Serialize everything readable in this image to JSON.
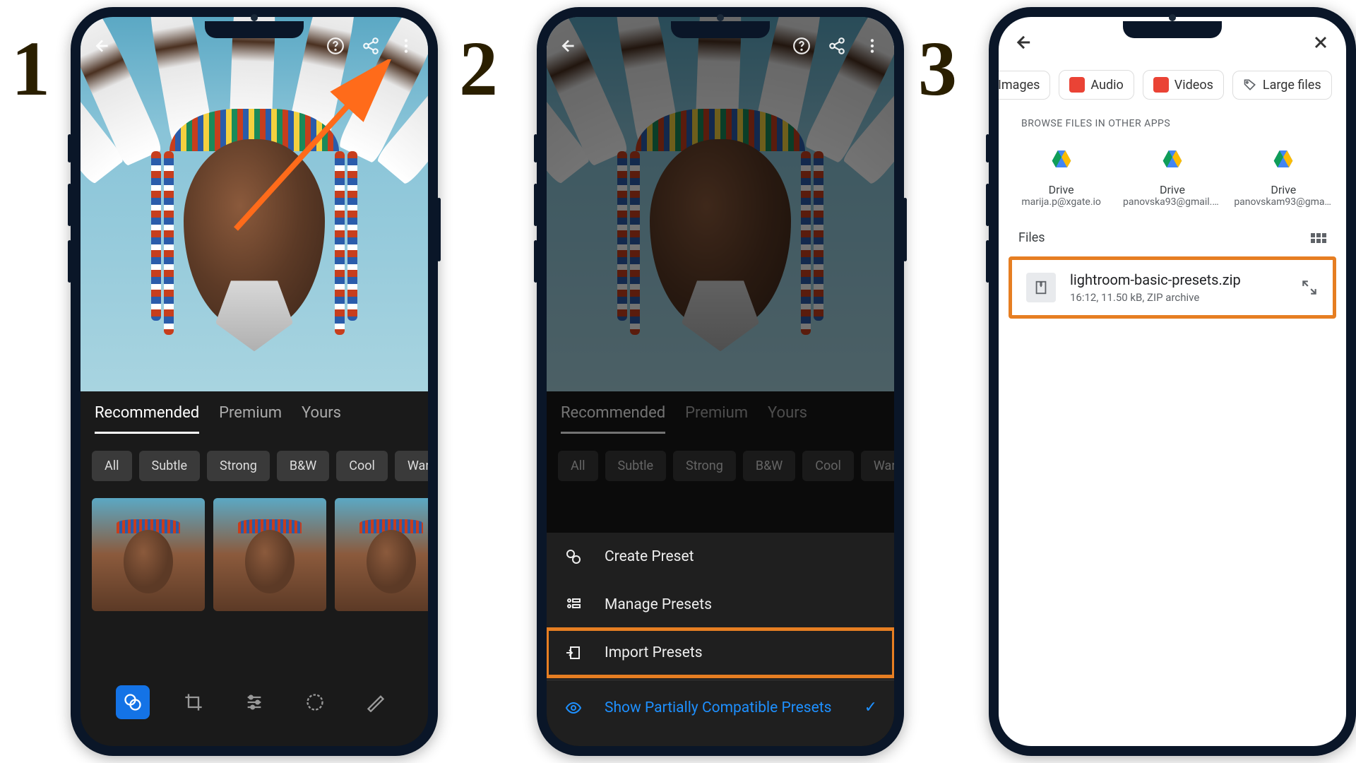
{
  "steps": [
    "1",
    "2",
    "3"
  ],
  "lightroom": {
    "tabs": [
      "Recommended",
      "Premium",
      "Yours"
    ],
    "activeTab": 0,
    "chips": [
      "All",
      "Subtle",
      "Strong",
      "B&W",
      "Cool",
      "Warm"
    ],
    "menu": {
      "create": "Create Preset",
      "manage": "Manage Presets",
      "import": "Import Presets",
      "show_partial": "Show Partially Compatible Presets"
    }
  },
  "filepicker": {
    "chips": {
      "images": "Images",
      "audio": "Audio",
      "videos": "Videos",
      "large": "Large files"
    },
    "browse_title": "BROWSE FILES IN OTHER APPS",
    "drives": [
      {
        "name": "Drive",
        "sub": "marija.p@xgate.io"
      },
      {
        "name": "Drive",
        "sub": "panovska93@gmail.c..."
      },
      {
        "name": "Drive",
        "sub": "panovskam93@gmail..."
      }
    ],
    "files_label": "Files",
    "file": {
      "name": "lightroom-basic-presets.zip",
      "meta": "16:12, 11.50 kB, ZIP archive"
    }
  }
}
